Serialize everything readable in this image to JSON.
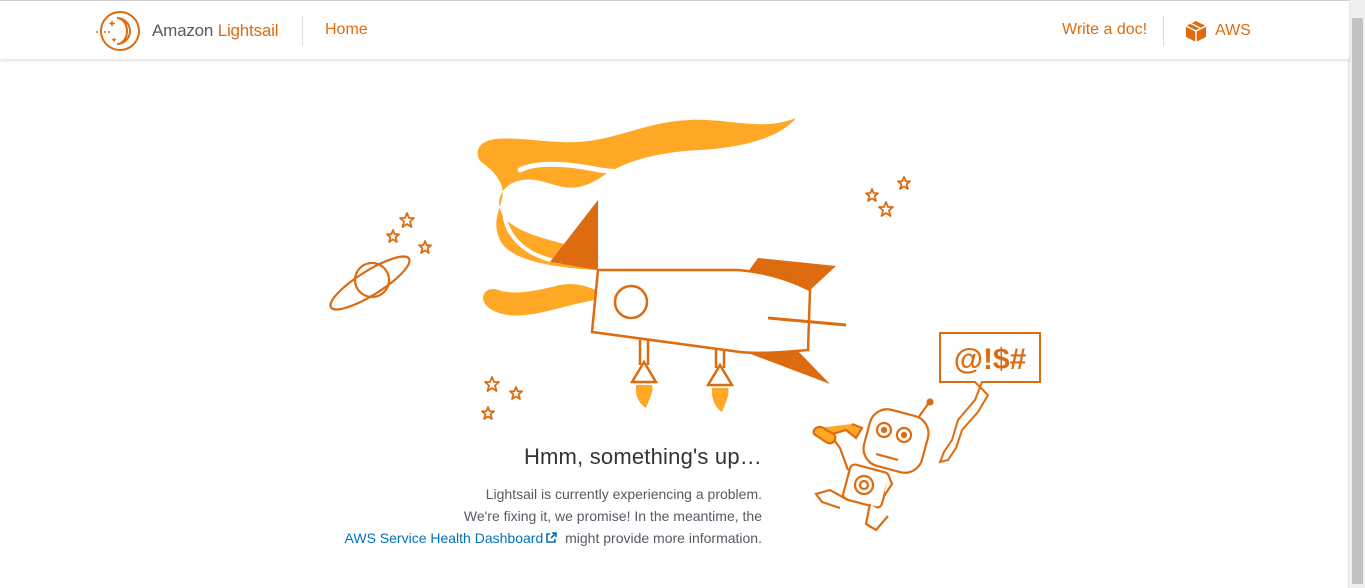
{
  "header": {
    "brand_prefix": "Amazon",
    "brand_name": "Lightsail",
    "home_label": "Home",
    "write_doc_label": "Write a doc!",
    "aws_label": "AWS"
  },
  "illustration": {
    "speech_bubble_text": "@!$#"
  },
  "message": {
    "title": "Hmm, something's up…",
    "line1": "Lightsail is currently experiencing a problem.",
    "line2": "We're fixing it, we promise! In the meantime, the",
    "link_text": "AWS Service Health Dashboard",
    "line3_suffix": "might provide more information."
  },
  "colors": {
    "accent": "#dd6b10",
    "flame": "#ffa826",
    "link": "#0073bb"
  },
  "icons": [
    "lightsail-logo-icon",
    "aws-cube-icon",
    "external-link-icon"
  ]
}
